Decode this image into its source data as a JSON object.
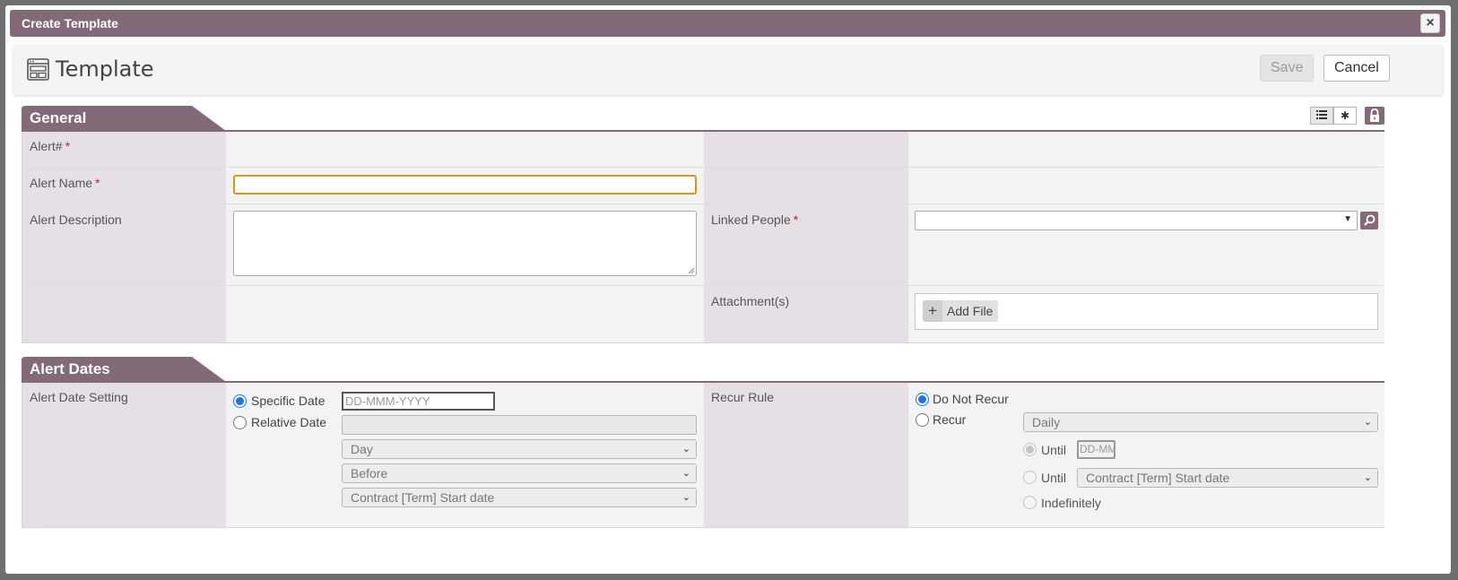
{
  "dialog": {
    "title": "Create Template",
    "close_label": "×"
  },
  "header": {
    "title": "Template",
    "save_label": "Save",
    "cancel_label": "Cancel"
  },
  "general": {
    "section_title": "General",
    "tools": {
      "list_view_icon": "list-icon",
      "asterisk_label": "✱",
      "lock_icon": "lock-icon"
    },
    "alert_no_label": "Alert#",
    "alert_name_label": "Alert Name",
    "alert_description_label": "Alert Description",
    "linked_people_label": "Linked People",
    "attachments_label": "Attachment(s)",
    "add_file_label": "Add File",
    "required_marker": "*"
  },
  "alert_dates": {
    "section_title": "Alert Dates",
    "alert_date_setting_label": "Alert Date Setting",
    "specific_date_label": "Specific Date",
    "relative_date_label": "Relative Date",
    "date_placeholder": "DD-MMM-YYYY",
    "unit_select": "Day",
    "direction_select": "Before",
    "reference_select": "Contract [Term] Start date",
    "recur_rule_label": "Recur Rule",
    "do_not_recur_label": "Do Not Recur",
    "recur_label": "Recur",
    "frequency_select": "Daily",
    "until_label": "Until",
    "until_date_placeholder": "DD-MMM-YYYY",
    "until_reference_select": "Contract [Term] Start date",
    "indefinitely_label": "Indefinitely"
  },
  "colors": {
    "accent": "#836a79",
    "label_bg": "#e6e0e6",
    "value_bg": "#f3f3f3",
    "focus": "#d09a1d",
    "radio": "#1a73e8"
  }
}
